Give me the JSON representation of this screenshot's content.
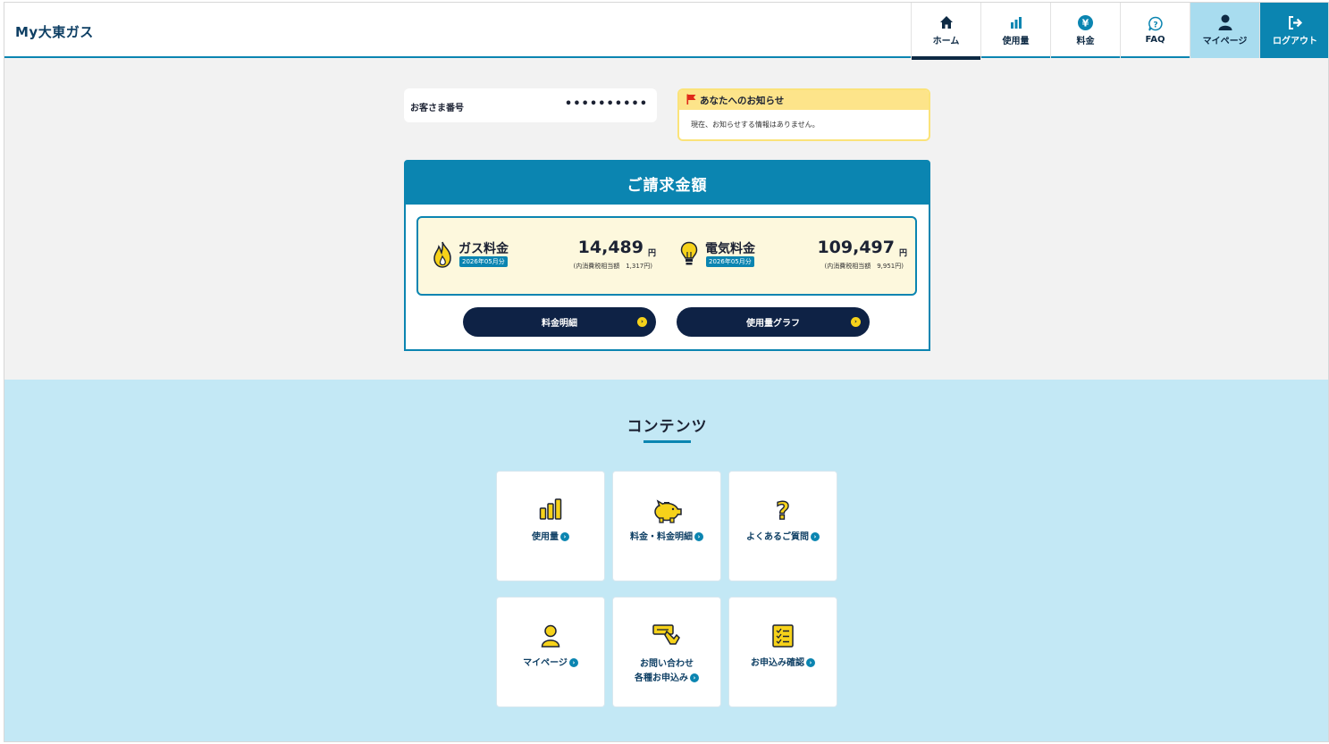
{
  "header": {
    "logo": "My大東ガス",
    "nav": [
      {
        "label": "ホーム",
        "icon": "home-icon"
      },
      {
        "label": "使用量",
        "icon": "bar-chart-icon"
      },
      {
        "label": "料金",
        "icon": "yen-icon"
      },
      {
        "label": "FAQ",
        "icon": "question-icon"
      },
      {
        "label": "マイページ",
        "icon": "user-icon"
      },
      {
        "label": "ログアウト",
        "icon": "logout-icon"
      }
    ]
  },
  "customer": {
    "label": "お客さま番号",
    "value": "••••••••••"
  },
  "notice": {
    "title": "あなたへのお知らせ",
    "body": "現在、お知らせする情報はありません。"
  },
  "billing": {
    "title": "ご請求金額",
    "gas": {
      "name": "ガス料金",
      "period": "2026年05月分",
      "amount": "14,489",
      "unit": "円",
      "tax": "(内消費税相当額　1,317円)"
    },
    "electric": {
      "name": "電気料金",
      "period": "2026年05月分",
      "amount": "109,497",
      "unit": "円",
      "tax": "(内消費税相当額　9,951円)"
    },
    "buttons": {
      "detail": "料金明細",
      "graph": "使用量グラフ"
    }
  },
  "contents": {
    "title": "コンテンツ",
    "tiles": [
      {
        "line1": "使用量",
        "line2": "",
        "icon": "bar-chart-icon"
      },
      {
        "line1": "料金・料金明細",
        "line2": "",
        "icon": "piggy-bank-icon"
      },
      {
        "line1": "よくあるご質問",
        "line2": "",
        "icon": "question-icon"
      },
      {
        "line1": "マイページ",
        "line2": "",
        "icon": "user-icon"
      },
      {
        "line1": "お問い合わせ",
        "line2": "各種お申込み",
        "icon": "form-hand-icon"
      },
      {
        "line1": "お申込み確認",
        "line2": "",
        "icon": "checklist-icon"
      }
    ]
  },
  "colors": {
    "accent": "#0b85b1",
    "navy": "#0e2245",
    "notice": "#fde48a",
    "contentsBg": "#c3e8f5",
    "iconYellow": "#f6d21a"
  }
}
